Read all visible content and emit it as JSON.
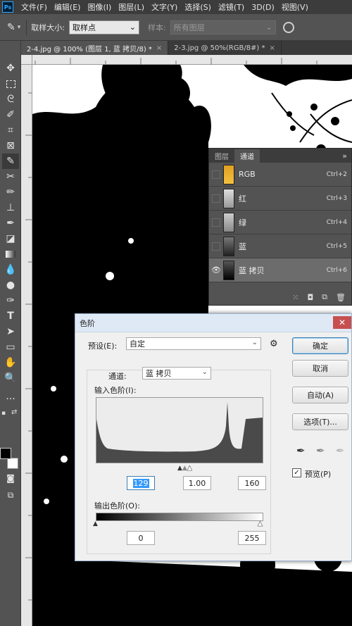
{
  "menu": [
    "文件(F)",
    "编辑(E)",
    "图像(I)",
    "图层(L)",
    "文字(Y)",
    "选择(S)",
    "滤镜(T)",
    "3D(D)",
    "视图(V)"
  ],
  "options": {
    "sample_size_label": "取样大小:",
    "sample_size_value": "取样点",
    "sample_label": "样本:",
    "sample_value": "所有图层"
  },
  "tabs": [
    {
      "label": "2-4.jpg @ 100% (图层 1, 蓝 拷贝/8) *",
      "active": true
    },
    {
      "label": "2-3.jpg @ 50%(RGB/8#) *",
      "active": false
    }
  ],
  "channels": {
    "tabs": [
      "图层",
      "通道"
    ],
    "active_tab": "通道",
    "rows": [
      {
        "name": "RGB",
        "shortcut": "Ctrl+2",
        "visible": false,
        "selected": false
      },
      {
        "name": "红",
        "shortcut": "Ctrl+3",
        "visible": false,
        "selected": false
      },
      {
        "name": "绿",
        "shortcut": "Ctrl+4",
        "visible": false,
        "selected": false
      },
      {
        "name": "蓝",
        "shortcut": "Ctrl+5",
        "visible": false,
        "selected": false
      },
      {
        "name": "蓝 拷贝",
        "shortcut": "Ctrl+6",
        "visible": true,
        "selected": true
      }
    ]
  },
  "levels": {
    "title": "色阶",
    "preset_label": "预设(E):",
    "preset_value": "自定",
    "channel_label": "通道:",
    "channel_value": "蓝 拷贝",
    "input_label": "输入色阶(I):",
    "input_values": {
      "black": "129",
      "gamma": "1.00",
      "white": "160"
    },
    "output_label": "输出色阶(O):",
    "output_values": {
      "black": "0",
      "white": "255"
    },
    "buttons": {
      "ok": "确定",
      "cancel": "取消",
      "auto": "自动(A)",
      "options": "选项(T)..."
    },
    "preview_label": "预览(P)",
    "preview_checked": true
  },
  "colors": {
    "accent": "#3c7fb1",
    "dialog_bg": "#f0f0f0",
    "panel_bg": "#535353"
  }
}
